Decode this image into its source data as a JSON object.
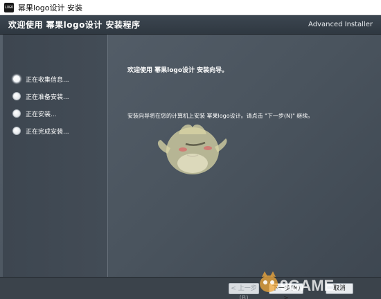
{
  "window": {
    "title": "幂果logo设计 安装",
    "icon_text": "LOGO"
  },
  "header": {
    "title": "欢迎使用 幂果logo设计 安装程序",
    "brand": "Advanced Installer"
  },
  "steps": [
    {
      "label": "正在收集信息...",
      "active": true
    },
    {
      "label": "正在准备安装...",
      "active": false
    },
    {
      "label": "正在安装...",
      "active": false
    },
    {
      "label": "正在完成安装...",
      "active": false
    }
  ],
  "content": {
    "welcome": "欢迎使用 幂果logo设计 安装向导。",
    "description": "安装向导将在您的计算机上安装 幂果logo设计。请点击 \"下一步(N)\" 继续。"
  },
  "buttons": {
    "back": "< 上一步(B)",
    "next": "下一步(N) >",
    "cancel": "取消"
  },
  "watermark": {
    "text": "9GAME"
  },
  "colors": {
    "header_bg": "#343d46",
    "main_bg": "#4a545e",
    "sidebar_bg": "#3f4852",
    "footer_bg": "#3b434b"
  }
}
